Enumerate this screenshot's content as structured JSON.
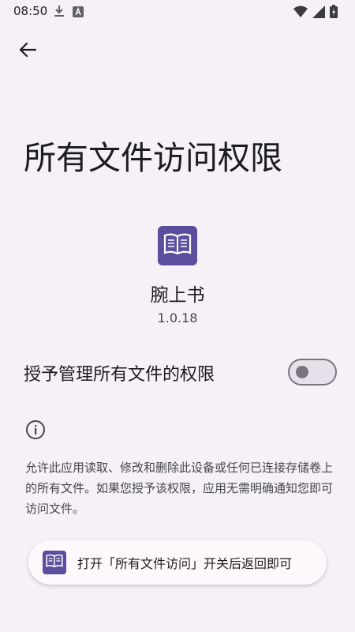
{
  "status_bar": {
    "time": "08:50",
    "left_icons": [
      "download-icon",
      "a-badge-icon"
    ],
    "right_icons": [
      "wifi-icon",
      "signal-icon",
      "battery-icon"
    ]
  },
  "nav": {
    "back_icon": "arrow-back-icon"
  },
  "page": {
    "title": "所有文件访问权限"
  },
  "app": {
    "name": "腕上书",
    "version": "1.0.18",
    "icon": "book-icon",
    "accent_color": "#5b4e9e"
  },
  "permission": {
    "label": "授予管理所有文件的权限",
    "toggle_state": "off"
  },
  "info": {
    "icon": "info-icon",
    "text": "允许此应用读取、修改和删除此设备或任何已连接存储卷上的所有文件。如果您授予该权限，应用无需明确通知您即可访问文件。"
  },
  "toast": {
    "icon": "book-icon",
    "text": "打开「所有文件访问」开关后返回即可"
  }
}
